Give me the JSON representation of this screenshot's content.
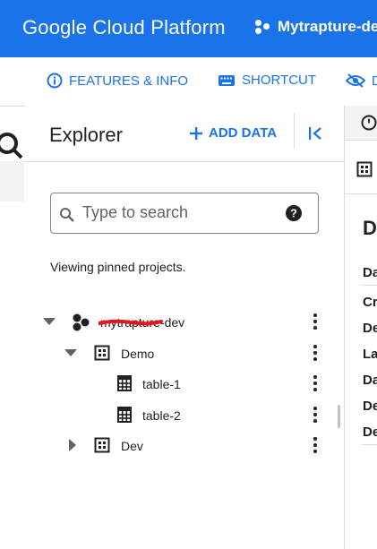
{
  "topbar": {
    "brand": "Google Cloud Platform",
    "project_name": "Mytrapture-dev",
    "color": "#1a73e8"
  },
  "toolbar": {
    "features_label": "FEATURES & INFO",
    "shortcut_label": "SHORTCUT",
    "hide_label": "D"
  },
  "explorer": {
    "title": "Explorer",
    "add_data_label": "ADD DATA",
    "search_placeholder": "Type to search",
    "pinned_text": "Viewing pinned projects.",
    "tree": [
      {
        "label": "mytrapture-dev",
        "type": "project",
        "expanded": true,
        "redacted": true
      },
      {
        "label": "Demo",
        "type": "dataset",
        "expanded": true
      },
      {
        "label": "table-1",
        "type": "table"
      },
      {
        "label": "table-2",
        "type": "table"
      },
      {
        "label": "Dev",
        "type": "dataset",
        "expanded": false
      }
    ]
  },
  "details_panel": {
    "heading": "D",
    "labels": [
      "Da",
      "Cr",
      "De",
      "La",
      "Da",
      "De",
      "De"
    ]
  },
  "colors": {
    "accent": "#1a73e8",
    "redaction": "#e8141c"
  }
}
